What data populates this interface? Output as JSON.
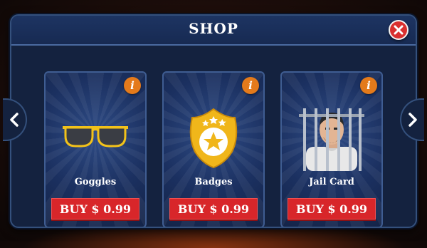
{
  "shop": {
    "title": "SHOP",
    "items": [
      {
        "name": "Goggles",
        "buy_label": "BUY $ 0.99",
        "info_label": "i",
        "icon": "sunglasses-icon"
      },
      {
        "name": "Badges",
        "buy_label": "BUY $ 0.99",
        "info_label": "i",
        "icon": "sheriff-badge-icon"
      },
      {
        "name": "Jail Card",
        "buy_label": "BUY $ 0.99",
        "info_label": "i",
        "icon": "jail-prisoner-icon"
      }
    ]
  },
  "colors": {
    "panel": "#14223f",
    "buy_button": "#d8262a",
    "info_button": "#e47a1b",
    "close_button": "#d9302f"
  }
}
